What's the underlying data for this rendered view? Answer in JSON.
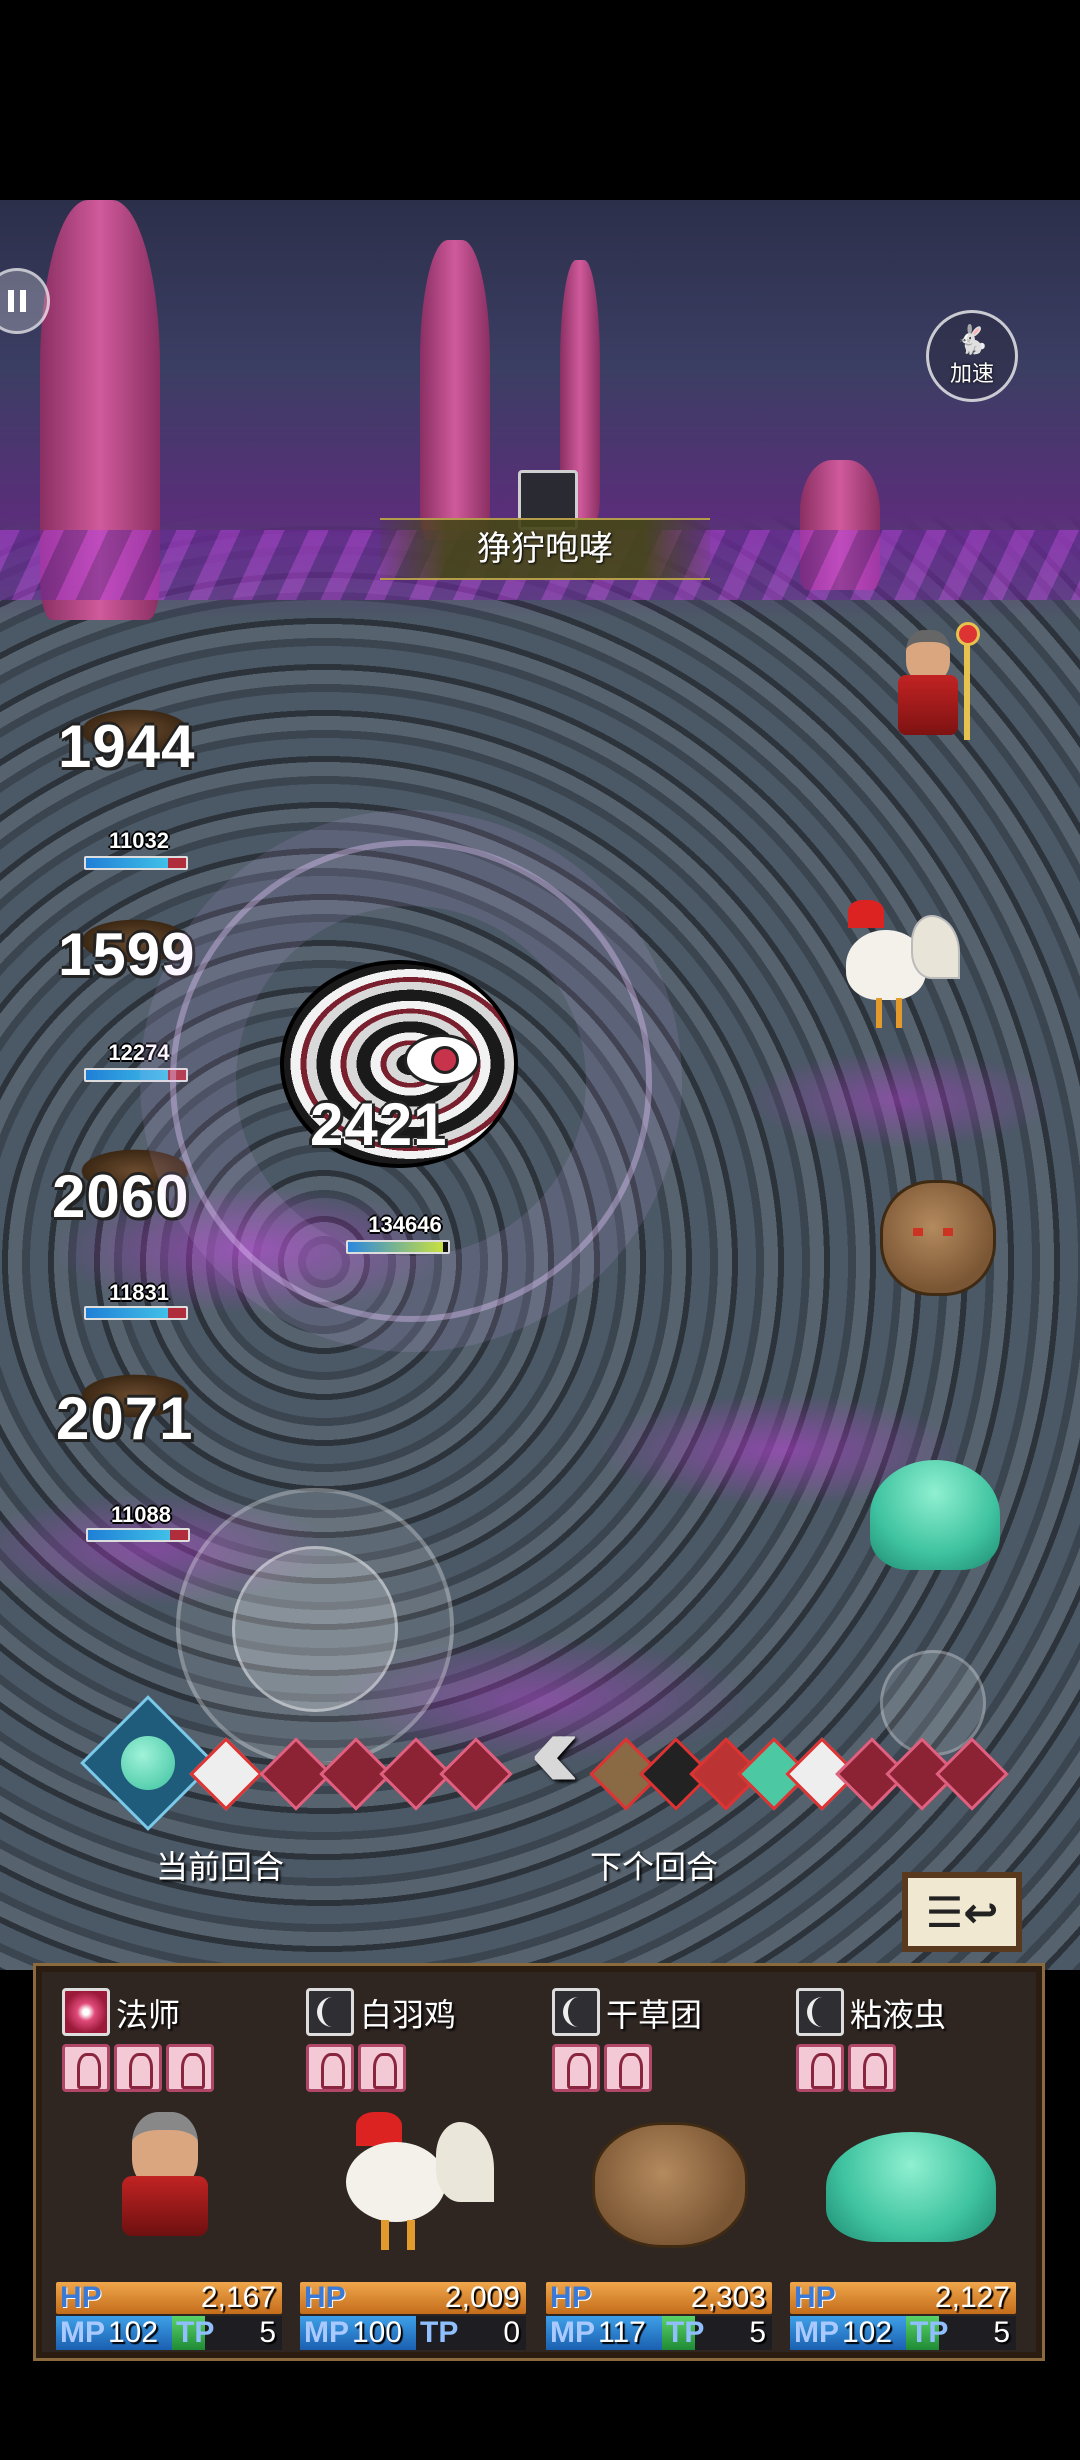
{
  "controls": {
    "speed_label": "加速"
  },
  "skill": {
    "name": "狰狞咆哮"
  },
  "enemies": [
    {
      "damage": "1944",
      "hp": "11032"
    },
    {
      "damage": "1599",
      "hp": "12274"
    },
    {
      "damage": "2060",
      "hp": "11831"
    },
    {
      "damage": "2071",
      "hp": "11088"
    }
  ],
  "boss": {
    "damage": "2421",
    "hp": "134646"
  },
  "turn_order": {
    "current_label": "当前回合",
    "next_label": "下个回合"
  },
  "party": [
    {
      "name": "法师",
      "hp": "2,167",
      "mp": "102",
      "tp": "5",
      "buffs": 3,
      "icon": "mage-icon"
    },
    {
      "name": "白羽鸡",
      "hp": "2,009",
      "mp": "100",
      "tp": "0",
      "buffs": 2,
      "icon": "claw-icon"
    },
    {
      "name": "干草团",
      "hp": "2,303",
      "mp": "117",
      "tp": "5",
      "buffs": 2,
      "icon": "claw-icon"
    },
    {
      "name": "粘液虫",
      "hp": "2,127",
      "mp": "102",
      "tp": "5",
      "buffs": 2,
      "icon": "claw-icon"
    }
  ],
  "labels": {
    "hp": "HP",
    "mp": "MP",
    "tp": "TP"
  },
  "colors": {
    "hp_bar": "#e08a2e",
    "mp_bar": "#2a7fd0",
    "tp_bar": "#3cb44a",
    "damage_text": "#ffffff"
  }
}
